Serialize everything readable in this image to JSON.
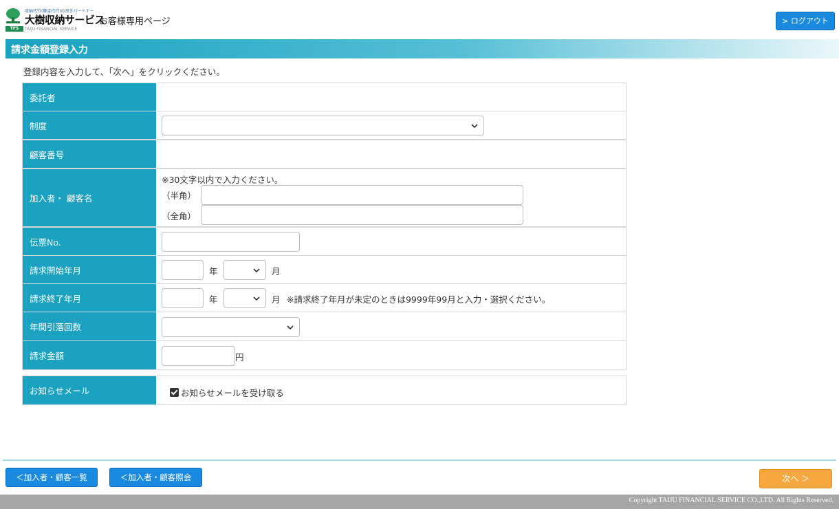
{
  "header": {
    "logo_tagline": "収納代行(集金代行)の良きパートナー",
    "logo_name": "大樹収納サービス",
    "logo_english": "TAIJU FINANCIAL SERVICE",
    "logo_mark": "TFS",
    "page_label": "お客様専用ページ",
    "logout_label": "> ログアウト"
  },
  "title": "請求金額登録入力",
  "instruction": "登録内容を入力して、「次へ」をクリックください。",
  "form": {
    "itakusha": {
      "label": "委託者",
      "value": ""
    },
    "seido": {
      "label": "制度",
      "selected": ""
    },
    "kokyaku_bango": {
      "label": "顧客番号",
      "value": ""
    },
    "kanyusha": {
      "label": "加入者・ 顧客名",
      "note": "※30文字以内で入力ください。",
      "hankaku_label": "（半角）",
      "zenkaku_label": "（全角）",
      "hankaku_value": "",
      "zenkaku_value": ""
    },
    "denpyo": {
      "label": "伝票No.",
      "value": ""
    },
    "start": {
      "label": "請求開始年月",
      "year_unit": "年",
      "month_unit": "月",
      "year_value": "",
      "month_selected": ""
    },
    "end": {
      "label": "請求終了年月",
      "year_unit": "年",
      "month_unit": "月",
      "note": "※請求終了年月が未定のときは9999年99月と入力・選択ください。",
      "year_value": "",
      "month_selected": ""
    },
    "annual_count": {
      "label": "年間引落回数",
      "selected": ""
    },
    "amount": {
      "label": "請求金額",
      "unit": "円",
      "value": ""
    },
    "notice_mail": {
      "label": "お知らせメール",
      "checkbox_label": "お知らせメールを受け取る",
      "checked": true
    }
  },
  "footer": {
    "back_list_label": "＜加入者・顧客一覧",
    "back_inquiry_label": "＜加入者・顧客照会",
    "next_label": "次へ ＞",
    "copyright": "Copyright TAIJU FINANCIAL SERVICE CO.,LTD. All Rights Reserved."
  },
  "colors": {
    "accent": "#1aa2c0",
    "button_blue": "#1a8ae0",
    "button_orange": "#f7a740"
  },
  "icons": {
    "logo": "tree-logo-icon",
    "select": "chevron-down-icon",
    "checkbox": "check-icon"
  }
}
